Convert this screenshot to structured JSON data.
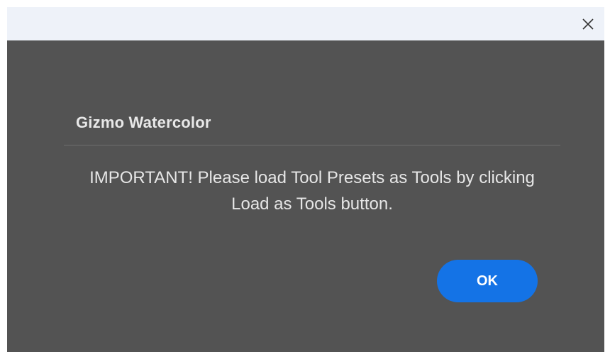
{
  "window": {
    "close_icon": "close-icon"
  },
  "dialog": {
    "title": "Gizmo Watercolor",
    "message": "IMPORTANT! Please load Tool Presets as Tools by clicking Load as Tools button.",
    "ok_label": "OK"
  },
  "colors": {
    "titlebar": "#eef2f9",
    "dialog_background": "#535353",
    "accent_button": "#1473e6",
    "text": "#e6e6e6"
  }
}
